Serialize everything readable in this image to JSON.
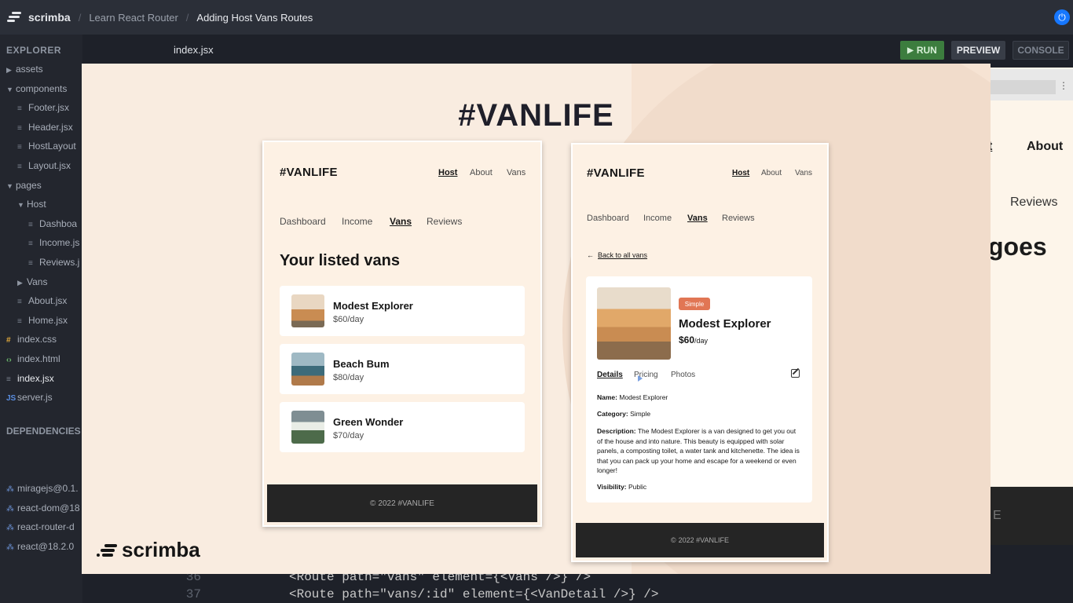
{
  "topbar": {
    "brand": "scrimba",
    "breadcrumbs": [
      "Learn React Router",
      "Adding Host Vans Routes"
    ],
    "power_icon": "power-icon"
  },
  "sidebar": {
    "explorer_title": "EXPLORER",
    "dependencies_title": "DEPENDENCIES",
    "tree": [
      {
        "label": "assets",
        "kind": "folder",
        "expanded": false
      },
      {
        "label": "components",
        "kind": "folder",
        "expanded": true
      },
      {
        "label": "Footer.jsx",
        "kind": "file"
      },
      {
        "label": "Header.jsx",
        "kind": "file"
      },
      {
        "label": "HostLayout",
        "kind": "file"
      },
      {
        "label": "Layout.jsx",
        "kind": "file"
      },
      {
        "label": "pages",
        "kind": "folder",
        "expanded": true
      },
      {
        "label": "Host",
        "kind": "folder",
        "expanded": true
      },
      {
        "label": "Dashboa",
        "kind": "file"
      },
      {
        "label": "Income.js",
        "kind": "file"
      },
      {
        "label": "Reviews.j",
        "kind": "file"
      },
      {
        "label": "Vans",
        "kind": "folder",
        "expanded": false
      },
      {
        "label": "About.jsx",
        "kind": "file"
      },
      {
        "label": "Home.jsx",
        "kind": "file"
      },
      {
        "label": "index.css",
        "kind": "css"
      },
      {
        "label": "index.html",
        "kind": "html"
      },
      {
        "label": "index.jsx",
        "kind": "file",
        "active": true
      },
      {
        "label": "server.js",
        "kind": "js"
      }
    ],
    "dependencies": [
      "miragejs@0.1.",
      "react-dom@18",
      "react-router-d",
      "react@18.2.0"
    ]
  },
  "editor": {
    "tab_name": "index.jsx",
    "run_label": "RUN",
    "preview_label": "PREVIEW",
    "console_label": "CONSOLE",
    "code_lines": [
      {
        "num": "36",
        "text": "<Route path=\"vans\" element={<Vans />} />"
      },
      {
        "num": "37",
        "text": "<Route path=\"vans/:id\" element={<VanDetail />} />"
      }
    ]
  },
  "preview_partial": {
    "nav_underlined_fragment": "t",
    "about": "About",
    "reviews": "Reviews",
    "heading_fragment": "goes",
    "footer_fragment": "E"
  },
  "slide": {
    "title": "#VANLIFE",
    "watermark": "scrimba",
    "left_phone": {
      "logo": "#VANLIFE",
      "nav": [
        "Host",
        "About",
        "Vans"
      ],
      "subnav": [
        "Dashboard",
        "Income",
        "Vans",
        "Reviews"
      ],
      "heading": "Your listed vans",
      "vans": [
        {
          "name": "Modest Explorer",
          "price": "$60/day",
          "color": "#c98c52"
        },
        {
          "name": "Beach Bum",
          "price": "$80/day",
          "color": "#3d6b7a"
        },
        {
          "name": "Green Wonder",
          "price": "$70/day",
          "color": "#4d6b4a"
        }
      ],
      "footer": "2022 #VANLIFE"
    },
    "right_phone": {
      "logo": "#VANLIFE",
      "nav": [
        "Host",
        "About",
        "Vans"
      ],
      "subnav": [
        "Dashboard",
        "Income",
        "Vans",
        "Reviews"
      ],
      "back_link": "Back to all vans",
      "badge": "Simple",
      "van_name": "Modest Explorer",
      "price": "$60",
      "price_unit": "/day",
      "tabs": [
        "Details",
        "Pricing",
        "Photos"
      ],
      "name_label": "Name:",
      "name_value": "Modest Explorer",
      "category_label": "Category:",
      "category_value": "Simple",
      "description_label": "Description:",
      "description_value": "The Modest Explorer is a van designed to get you out of the house and into nature. This beauty is equipped with solar panels, a composting toilet, a water tank and kitchenette. The idea is that you can pack up your home and escape for a weekend or even longer!",
      "visibility_label": "Visibility:",
      "visibility_value": "Public",
      "footer": "2022 #VANLIFE"
    }
  },
  "colors": {
    "brand_bg": "#f6e3d3",
    "badge": "#e17654",
    "run_green": "#3c7d3e",
    "footer_dark": "#252525"
  }
}
